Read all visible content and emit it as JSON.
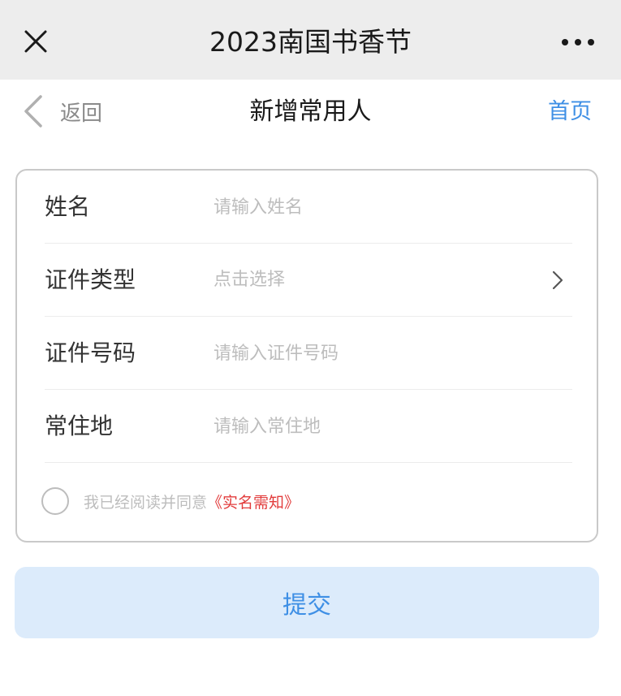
{
  "topbar": {
    "title": "2023南国书香节",
    "close_icon": "close-icon",
    "more_icon": "more-dots-icon"
  },
  "navbar": {
    "back_label": "返回",
    "back_icon": "chevron-left-icon",
    "title": "新增常用人",
    "home_label": "首页"
  },
  "form": {
    "name": {
      "label": "姓名",
      "placeholder": "请输入姓名",
      "value": ""
    },
    "id_type": {
      "label": "证件类型",
      "placeholder": "点击选择",
      "icon": "chevron-right-icon"
    },
    "id_number": {
      "label": "证件号码",
      "placeholder": "请输入证件号码",
      "value": ""
    },
    "residence": {
      "label": "常住地",
      "placeholder": "请输入常住地",
      "value": ""
    },
    "agreement": {
      "text": "我已经阅读并同意",
      "link": "《实名需知》",
      "checked": false
    }
  },
  "submit": {
    "label": "提交"
  },
  "colors": {
    "accent": "#3e8fe5",
    "submit_bg": "#dcebfb",
    "link_red": "#e23c3c",
    "topbar_bg": "#ededed"
  }
}
